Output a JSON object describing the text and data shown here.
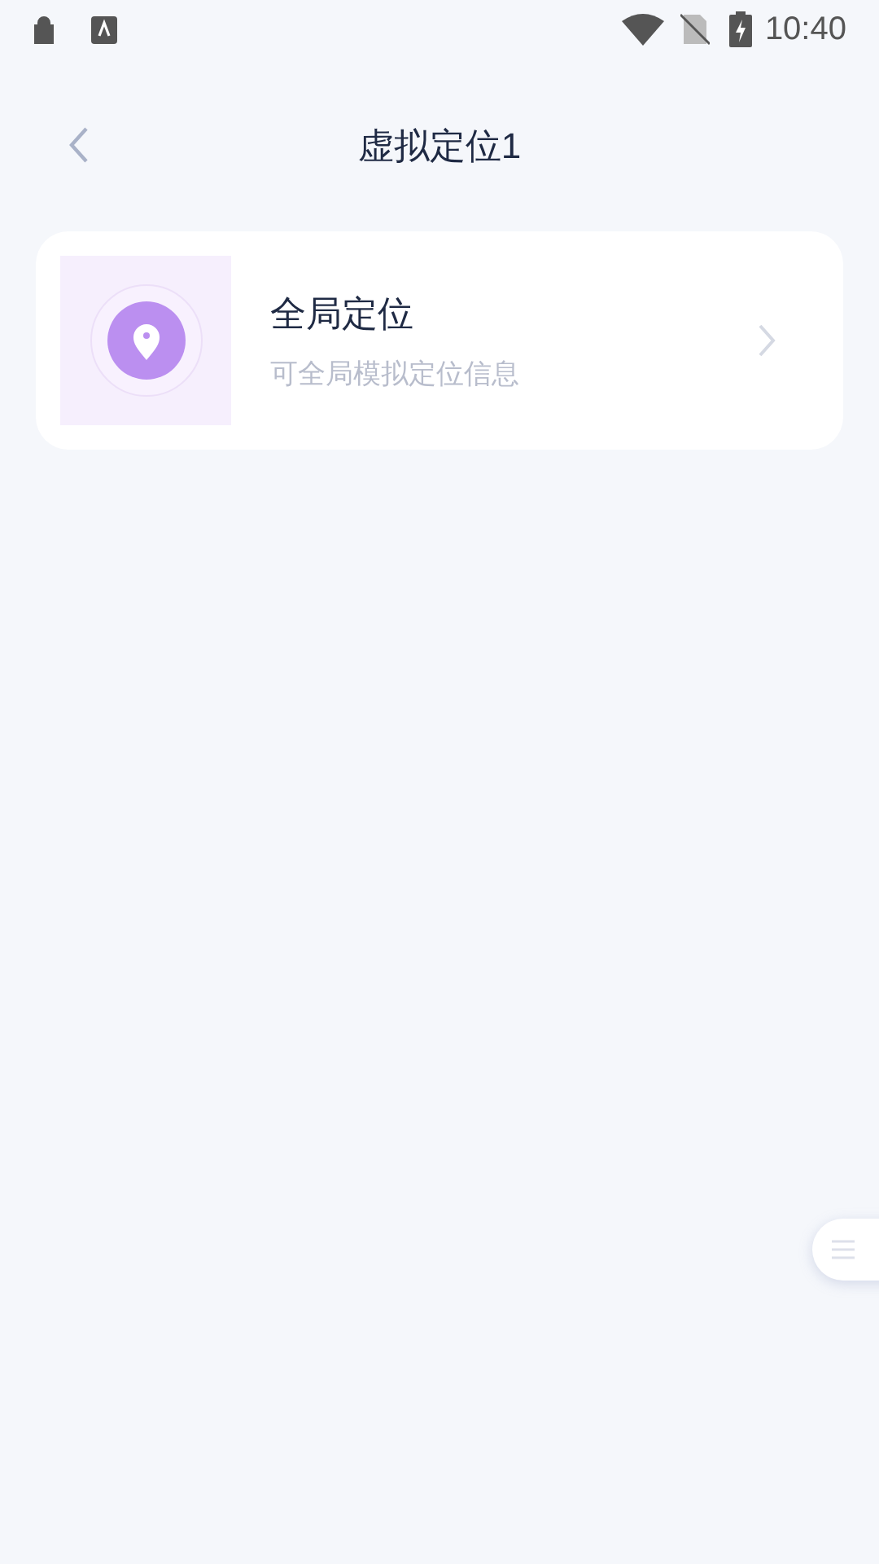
{
  "status_bar": {
    "time": "10:40"
  },
  "header": {
    "title": "虚拟定位1"
  },
  "items": [
    {
      "title": "全局定位",
      "subtitle": "可全局模拟定位信息"
    }
  ]
}
